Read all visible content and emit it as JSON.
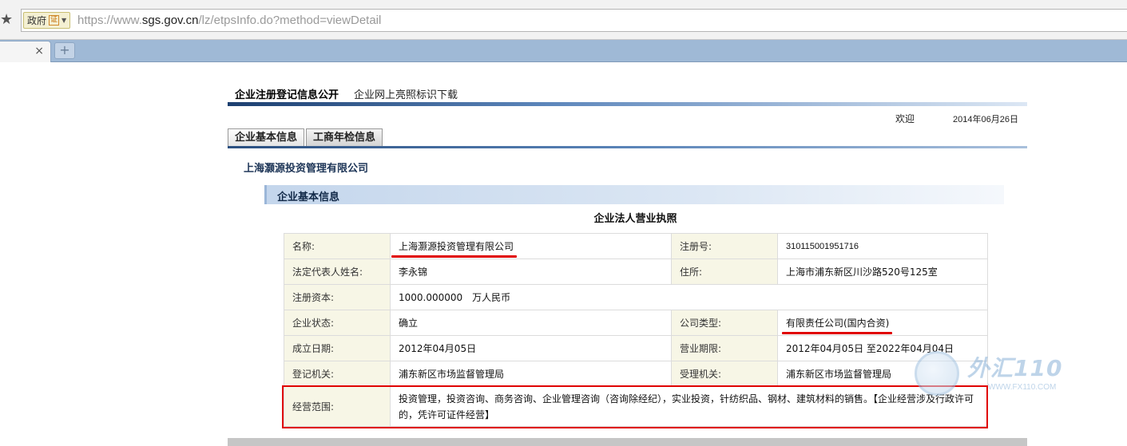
{
  "browser": {
    "badge_text": "政府",
    "badge_cert": "证",
    "url_scheme": "https://www.",
    "url_host": "sgs.gov.cn",
    "url_path": "/lz/etpsInfo.do?method=viewDetail",
    "tab_close": "×",
    "new_tab": "+"
  },
  "nav": {
    "items": [
      "企业注册登记信息公开",
      "企业网上亮照标识下载"
    ]
  },
  "header": {
    "welcome": "欢迎",
    "date": "2014年06月26日"
  },
  "subtabs": [
    "企业基本信息",
    "工商年检信息"
  ],
  "company": {
    "name": "上海灏源投资管理有限公司"
  },
  "section": {
    "title": "企业基本信息",
    "license_title": "企业法人营业执照"
  },
  "table": {
    "name_label": "名称:",
    "name_value": "上海灏源投资管理有限公司",
    "reg_no_label": "注册号:",
    "reg_no_value": "310115001951716",
    "rep_label": "法定代表人姓名:",
    "rep_value": "李永锦",
    "address_label": "住所:",
    "address_value": "上海市浦东新区川沙路520号125室",
    "capital_label": "注册资本:",
    "capital_value": "1000.000000　万人民币",
    "status_label": "企业状态:",
    "status_value": "确立",
    "type_label": "公司类型:",
    "type_value": "有限责任公司(国内合资)",
    "founded_label": "成立日期:",
    "founded_value": "2012年04月05日",
    "term_label": "营业期限:",
    "term_value": "2012年04月05日 至2022年04月04日",
    "authority_label": "登记机关:",
    "authority_value": "浦东新区市场监督管理局",
    "accept_label": "受理机关:",
    "accept_value": "浦东新区市场监督管理局",
    "scope_label": "经营范围:",
    "scope_value": "投资管理，投资咨询、商务咨询、企业管理咨询（咨询除经纪），实业投资，针纺织品、钢材、建筑材料的销售。【企业经营涉及行政许可的，凭许可证件经营】"
  },
  "watermark": {
    "text": "外汇110",
    "sub": "WWW.FX110.COM"
  },
  "colors": {
    "accent_red": "#e00000",
    "nav_blue": "#1c3f70",
    "label_bg": "#f7f6e6"
  }
}
